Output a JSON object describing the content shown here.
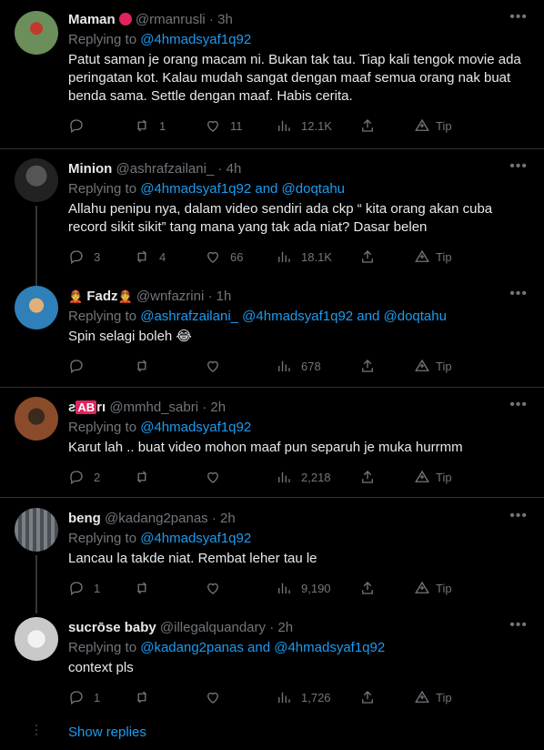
{
  "tweets": [
    {
      "name": "Maman",
      "handle": "@rmanrusli",
      "time": "3h",
      "replying_label": "Replying to",
      "replying_to": "@4hmadsyaf1q92",
      "body": "Patut saman je orang macam ni. Bukan tak tau. Tiap kali tengok movie ada peringatan kot. Kalau mudah sangat dengan maaf semua orang nak buat benda sama. Settle dengan maaf. Habis cerita.",
      "replies": "",
      "retweets": "1",
      "likes": "11",
      "views": "12.1K",
      "tip": "Tip",
      "avatar_color": "#6b8e5a"
    },
    {
      "name": "Minion",
      "handle": "@ashrafzailani_",
      "time": "4h",
      "replying_label": "Replying to",
      "replying_to": "@4hmadsyaf1q92 and @doqtahu",
      "body": "Allahu penipu nya, dalam video sendiri ada ckp “ kita orang akan cuba record sikit sikit” tang mana yang tak ada niat? Dasar belen",
      "replies": "3",
      "retweets": "4",
      "likes": "66",
      "views": "18.1K",
      "tip": "Tip",
      "avatar_color": "#3a3a3a"
    },
    {
      "name": "Fadz",
      "name_prefix": "👲",
      "name_suffix": "👲",
      "handle": "@wnfazrini",
      "time": "1h",
      "replying_label": "Replying to",
      "replying_to": "@ashrafzailani_ @4hmadsyaf1q92 and @doqtahu",
      "body": "Spin selagi boleh 😂",
      "replies": "",
      "retweets": "",
      "likes": "",
      "views": "678",
      "tip": "Tip",
      "avatar_color": "#2f7fb8"
    },
    {
      "name_prefix": "ƨ",
      "name_badge": "AB",
      "name_suffix": "rı",
      "handle": "@mmhd_sabri",
      "time": "2h",
      "replying_label": "Replying to",
      "replying_to": "@4hmadsyaf1q92",
      "body": "Karut lah .. buat video mohon maaf pun separuh je muka hurrmm",
      "replies": "2",
      "retweets": "",
      "likes": "",
      "views": "2,218",
      "tip": "Tip",
      "avatar_color": "#8a4b2a"
    },
    {
      "name": "beng",
      "handle": "@kadang2panas",
      "time": "2h",
      "replying_label": "Replying to",
      "replying_to": "@4hmadsyaf1q92",
      "body": "Lancau la takde niat. Rembat leher tau le",
      "replies": "1",
      "retweets": "",
      "likes": "",
      "views": "9,190",
      "tip": "Tip",
      "avatar_color": "#7a7f86"
    },
    {
      "name": "sucrōse baby",
      "handle": "@illegalquandary",
      "time": "2h",
      "replying_label": "Replying to",
      "replying_to": "@kadang2panas and @4hmadsyaf1q92",
      "body": "context pls",
      "replies": "1",
      "retweets": "",
      "likes": "",
      "views": "1,726",
      "tip": "Tip",
      "avatar_color": "#c9c9c9"
    }
  ],
  "show_replies": "Show replies"
}
